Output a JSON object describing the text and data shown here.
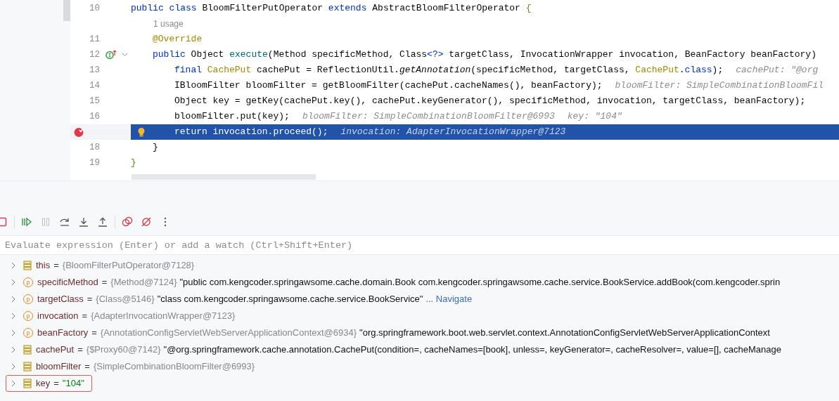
{
  "editor": {
    "lines": [
      {
        "number": "10",
        "tokens": [
          {
            "t": "public ",
            "kind": "kw"
          },
          {
            "t": "class ",
            "kind": "kw"
          },
          {
            "t": "BloomFilterPutOperator ",
            "kind": "plain"
          },
          {
            "t": "extends ",
            "kind": "kw"
          },
          {
            "t": "AbstractBloomFilterOperator ",
            "kind": "plain"
          },
          {
            "t": "{",
            "kind": "brace"
          }
        ],
        "children": [
          {
            "kind": "inlay",
            "text": "1 usage"
          },
          {
            "number": "11",
            "tokens": [
              {
                "t": "@Override",
                "kind": "ann"
              }
            ]
          },
          {
            "number": "12",
            "implements": true,
            "fold": true,
            "tokens": [
              {
                "t": "public ",
                "kind": "kw"
              },
              {
                "t": "Object ",
                "kind": "plain"
              },
              {
                "t": "execute",
                "kind": "method"
              },
              {
                "t": "(",
                "kind": "paren"
              },
              {
                "t": "Method specificMethod, Class",
                "kind": "plain"
              },
              {
                "t": "<?>",
                "kind": "kw"
              },
              {
                "t": " targetClass, InvocationWrapper invocation, BeanFactory beanFactory",
                "kind": "plain"
              },
              {
                "t": ")",
                "kind": "paren"
              }
            ],
            "children": [
              {
                "number": "13",
                "tokens": [
                  {
                    "t": "final ",
                    "kind": "kw"
                  },
                  {
                    "t": "CachePut ",
                    "kind": "ann"
                  },
                  {
                    "t": "cachePut = ReflectionUtil.",
                    "kind": "plain"
                  },
                  {
                    "t": "getAnnotation",
                    "kind": "italic"
                  },
                  {
                    "t": "(",
                    "kind": "paren"
                  },
                  {
                    "t": "specificMethod, targetClass, ",
                    "kind": "plain"
                  },
                  {
                    "t": "CachePut",
                    "kind": "ann"
                  },
                  {
                    "t": ".",
                    "kind": "plain"
                  },
                  {
                    "t": "class",
                    "kind": "kw"
                  },
                  {
                    "t": ")",
                    "kind": "paren"
                  },
                  {
                    "t": ";",
                    "kind": "plain"
                  }
                ],
                "hints": [
                  "cachePut: \"@org"
                ]
              },
              {
                "number": "14",
                "tokens": [
                  {
                    "t": "IBloomFilter bloomFilter = getBloomFilter",
                    "kind": "plain"
                  },
                  {
                    "t": "(",
                    "kind": "paren"
                  },
                  {
                    "t": "cachePut.cacheNames",
                    "kind": "plain"
                  },
                  {
                    "t": "()",
                    "kind": "paren"
                  },
                  {
                    "t": ", beanFactory",
                    "kind": "plain"
                  },
                  {
                    "t": ")",
                    "kind": "paren"
                  },
                  {
                    "t": ";",
                    "kind": "plain"
                  }
                ],
                "hints": [
                  "bloomFilter: SimpleCombinationBloomFil"
                ]
              },
              {
                "number": "15",
                "tokens": [
                  {
                    "t": "Object key = getKey",
                    "kind": "plain"
                  },
                  {
                    "t": "(",
                    "kind": "paren"
                  },
                  {
                    "t": "cachePut.key",
                    "kind": "plain"
                  },
                  {
                    "t": "()",
                    "kind": "paren"
                  },
                  {
                    "t": ", cachePut.keyGenerator",
                    "kind": "plain"
                  },
                  {
                    "t": "()",
                    "kind": "paren"
                  },
                  {
                    "t": ", specificMethod, invocation, targetClass, beanFactory",
                    "kind": "plain"
                  },
                  {
                    "t": ")",
                    "kind": "paren"
                  },
                  {
                    "t": ";",
                    "kind": "plain"
                  }
                ]
              },
              {
                "number": "16",
                "tokens": [
                  {
                    "t": "bloomFilter.put",
                    "kind": "plain"
                  },
                  {
                    "t": "(",
                    "kind": "paren"
                  },
                  {
                    "t": "key",
                    "kind": "plain"
                  },
                  {
                    "t": ")",
                    "kind": "paren"
                  },
                  {
                    "t": ";",
                    "kind": "plain"
                  }
                ],
                "hints": [
                  "bloomFilter: SimpleCombinationBloomFilter@6993",
                  "key: \"104\""
                ]
              },
              {
                "breakpoint": true,
                "bulb": true,
                "selected": true,
                "tokens": [
                  {
                    "t": "return ",
                    "kind": "kw"
                  },
                  {
                    "t": "invocation.proceed",
                    "kind": "plain"
                  },
                  {
                    "t": "()",
                    "kind": "paren"
                  },
                  {
                    "t": ";",
                    "kind": "plain"
                  }
                ],
                "hints": [
                  "invocation: AdapterInvocationWrapper@7123"
                ]
              }
            ]
          },
          {
            "number": "18",
            "tokens": [
              {
                "t": "}",
                "kind": "paren"
              }
            ]
          }
        ]
      },
      {
        "number": "19",
        "tokens": [
          {
            "t": "}",
            "kind": "brace"
          }
        ]
      }
    ]
  },
  "debugger": {
    "evaluate": {
      "placeholder": "Evaluate expression (Enter) or add a watch (Ctrl+Shift+Enter)"
    },
    "variables": [
      {
        "kind": "field",
        "name": "this",
        "operator": "=",
        "type": "{BloomFilterPutOperator@7128}",
        "outlined": false
      },
      {
        "kind": "param",
        "badge": "p",
        "name": "specificMethod",
        "operator": "=",
        "type": "{Method@7124}",
        "value": "\"public com.kengcoder.springawsome.cache.domain.Book com.kengcoder.springawsome.cache.service.BookService.addBook(com.kengcoder.sprin",
        "outlined": false
      },
      {
        "kind": "param",
        "badge": "p",
        "name": "targetClass",
        "operator": "=",
        "type": "{Class@5146}",
        "value": "\"class com.kengcoder.springawsome.cache.service.BookService\"",
        "link": "... Navigate",
        "outlined": false
      },
      {
        "kind": "param",
        "badge": "p",
        "name": "invocation",
        "operator": "=",
        "type": "{AdapterInvocationWrapper@7123}",
        "outlined": false
      },
      {
        "kind": "param",
        "badge": "p",
        "name": "beanFactory",
        "operator": "=",
        "type": "{AnnotationConfigServletWebServerApplicationContext@6934}",
        "value": "\"org.springframework.boot.web.servlet.context.AnnotationConfigServletWebServerApplicationContext",
        "outlined": false
      },
      {
        "kind": "field",
        "name": "cachePut",
        "operator": "=",
        "type": "{$Proxy60@7142}",
        "value": "\"@org.springframework.cache.annotation.CachePut(condition=, cacheNames=[book], unless=, keyGenerator=, cacheResolver=, value=[], cacheManage",
        "outlined": false
      },
      {
        "kind": "field",
        "name": "bloomFilter",
        "operator": "=",
        "type": "{SimpleCombinationBloomFilter@6993}",
        "outlined": false
      },
      {
        "kind": "field",
        "name": "key",
        "operator": "=",
        "string": "\"104\"",
        "outlined": true
      }
    ]
  }
}
